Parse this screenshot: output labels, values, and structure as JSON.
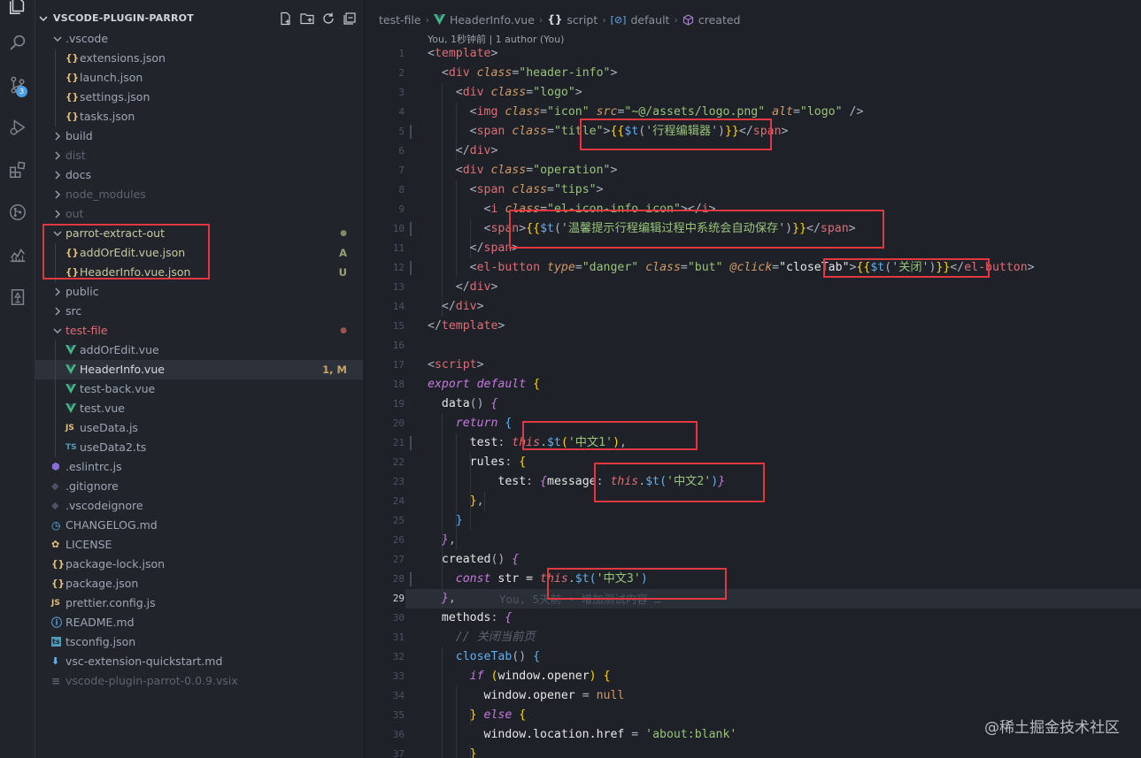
{
  "explorer": {
    "title": "VSCODE-PLUGIN-PARROT",
    "items": [
      {
        "label": ".vscode",
        "kind": "folder-open",
        "depth": 1,
        "color": "#9da5b4"
      },
      {
        "label": "extensions.json",
        "kind": "json",
        "depth": 2,
        "color": "#9da5b4"
      },
      {
        "label": "launch.json",
        "kind": "json",
        "depth": 2,
        "color": "#9da5b4"
      },
      {
        "label": "settings.json",
        "kind": "json",
        "depth": 2,
        "color": "#9da5b4"
      },
      {
        "label": "tasks.json",
        "kind": "json",
        "depth": 2,
        "color": "#9da5b4"
      },
      {
        "label": "build",
        "kind": "folder",
        "depth": 1,
        "color": "#9da5b4"
      },
      {
        "label": "dist",
        "kind": "folder",
        "depth": 1,
        "color": "#5c6370"
      },
      {
        "label": "docs",
        "kind": "folder",
        "depth": 1,
        "color": "#9da5b4"
      },
      {
        "label": "node_modules",
        "kind": "folder",
        "depth": 1,
        "color": "#5c6370"
      },
      {
        "label": "out",
        "kind": "folder",
        "depth": 1,
        "color": "#5c6370"
      },
      {
        "label": "parrot-extract-out",
        "kind": "folder-open",
        "depth": 1,
        "color": "#c5c9a0",
        "decoration": "●",
        "decoColor": "#7a8a6a"
      },
      {
        "label": "addOrEdit.vue.json",
        "kind": "json",
        "depth": 2,
        "color": "#c5c9a0",
        "decoration": "A",
        "decoColor": "#9aa27a"
      },
      {
        "label": "HeaderInfo.vue.json",
        "kind": "json",
        "depth": 2,
        "color": "#c5c9a0",
        "decoration": "U",
        "decoColor": "#9aa27a"
      },
      {
        "label": "public",
        "kind": "folder",
        "depth": 1,
        "color": "#9da5b4"
      },
      {
        "label": "src",
        "kind": "folder",
        "depth": 1,
        "color": "#9da5b4"
      },
      {
        "label": "test-file",
        "kind": "folder-open",
        "depth": 1,
        "color": "#e06c75",
        "decoration": "●",
        "decoColor": "#a0504f"
      },
      {
        "label": "addOrEdit.vue",
        "kind": "vue",
        "depth": 2,
        "color": "#9da5b4"
      },
      {
        "label": "HeaderInfo.vue",
        "kind": "vue",
        "depth": 2,
        "color": "#d7dae0",
        "decoration": "1, M",
        "decoColor": "#c9a26a",
        "selected": true
      },
      {
        "label": "test-back.vue",
        "kind": "vue",
        "depth": 2,
        "color": "#9da5b4"
      },
      {
        "label": "test.vue",
        "kind": "vue",
        "depth": 2,
        "color": "#9da5b4"
      },
      {
        "label": "useData.js",
        "kind": "js",
        "depth": 2,
        "color": "#9da5b4"
      },
      {
        "label": "useData2.ts",
        "kind": "ts",
        "depth": 2,
        "color": "#9da5b4"
      },
      {
        "label": ".eslintrc.js",
        "kind": "eslint",
        "depth": 1,
        "color": "#9da5b4"
      },
      {
        "label": ".gitignore",
        "kind": "git",
        "depth": 1,
        "color": "#9da5b4"
      },
      {
        "label": ".vscodeignore",
        "kind": "git",
        "depth": 1,
        "color": "#9da5b4"
      },
      {
        "label": "CHANGELOG.md",
        "kind": "clock",
        "depth": 1,
        "color": "#9da5b4"
      },
      {
        "label": "LICENSE",
        "kind": "license",
        "depth": 1,
        "color": "#9da5b4"
      },
      {
        "label": "package-lock.json",
        "kind": "json",
        "depth": 1,
        "color": "#9da5b4"
      },
      {
        "label": "package.json",
        "kind": "json",
        "depth": 1,
        "color": "#9da5b4"
      },
      {
        "label": "prettier.config.js",
        "kind": "js",
        "depth": 1,
        "color": "#9da5b4"
      },
      {
        "label": "README.md",
        "kind": "info",
        "depth": 1,
        "color": "#9da5b4"
      },
      {
        "label": "tsconfig.json",
        "kind": "tsconfig",
        "depth": 1,
        "color": "#9da5b4"
      },
      {
        "label": "vsc-extension-quickstart.md",
        "kind": "download",
        "depth": 1,
        "color": "#9da5b4"
      },
      {
        "label": "vscode-plugin-parrot-0.0.9.vsix",
        "kind": "lines",
        "depth": 1,
        "color": "#5c6370"
      }
    ]
  },
  "activity": {
    "scm_badge": "3"
  },
  "breadcrumb": {
    "folder": "test-file",
    "file": "HeaderInfo.vue",
    "section": "script",
    "symbol1": "default",
    "symbol2": "created"
  },
  "editor": {
    "blame_header": "You, 1秒钟前 | 1 author (You)",
    "current_line": 29,
    "inline_blame": "You, 5天前 • 增加测试内容 …",
    "lines": [
      [
        [
          "<",
          "t-pun"
        ],
        [
          "template",
          "t-tag"
        ],
        [
          ">",
          "t-pun"
        ]
      ],
      [
        [
          "  <",
          "t-pun"
        ],
        [
          "div",
          "t-tag"
        ],
        [
          " ",
          "t-pun"
        ],
        [
          "class",
          "t-attr"
        ],
        [
          "=",
          "t-pun"
        ],
        [
          "\"header-info\"",
          "t-str"
        ],
        [
          ">",
          "t-pun"
        ]
      ],
      [
        [
          "    <",
          "t-pun"
        ],
        [
          "div",
          "t-tag"
        ],
        [
          " ",
          "t-pun"
        ],
        [
          "class",
          "t-attr"
        ],
        [
          "=",
          "t-pun"
        ],
        [
          "\"logo\"",
          "t-str"
        ],
        [
          ">",
          "t-pun"
        ]
      ],
      [
        [
          "      <",
          "t-pun"
        ],
        [
          "img",
          "t-tag"
        ],
        [
          " ",
          "t-pun"
        ],
        [
          "class",
          "t-attr"
        ],
        [
          "=",
          "t-pun"
        ],
        [
          "\"icon\"",
          "t-str"
        ],
        [
          " ",
          "t-pun"
        ],
        [
          "src",
          "t-attr"
        ],
        [
          "=",
          "t-pun"
        ],
        [
          "\"~@/assets/logo.png\"",
          "t-str"
        ],
        [
          " ",
          "t-pun"
        ],
        [
          "alt",
          "t-attr"
        ],
        [
          "=",
          "t-pun"
        ],
        [
          "\"logo\"",
          "t-str"
        ],
        [
          " />",
          "t-pun"
        ]
      ],
      [
        [
          "      <",
          "t-pun"
        ],
        [
          "span",
          "t-tag"
        ],
        [
          " ",
          "t-pun"
        ],
        [
          "class",
          "t-attr"
        ],
        [
          "=",
          "t-pun"
        ],
        [
          "\"title\"",
          "t-str"
        ],
        [
          ">",
          "t-pun"
        ],
        [
          "{{",
          "t-brace"
        ],
        [
          "$t",
          "t-fn"
        ],
        [
          "('",
          "t-pun"
        ],
        [
          "行程编辑器",
          "t-str"
        ],
        [
          "')",
          "t-pun"
        ],
        [
          "}}",
          "t-brace"
        ],
        [
          "</",
          "t-pun"
        ],
        [
          "span",
          "t-tag"
        ],
        [
          ">",
          "t-pun"
        ]
      ],
      [
        [
          "    </",
          "t-pun"
        ],
        [
          "div",
          "t-tag"
        ],
        [
          ">",
          "t-pun"
        ]
      ],
      [
        [
          "    <",
          "t-pun"
        ],
        [
          "div",
          "t-tag"
        ],
        [
          " ",
          "t-pun"
        ],
        [
          "class",
          "t-attr"
        ],
        [
          "=",
          "t-pun"
        ],
        [
          "\"operation\"",
          "t-str"
        ],
        [
          ">",
          "t-pun"
        ]
      ],
      [
        [
          "      <",
          "t-pun"
        ],
        [
          "span",
          "t-tag"
        ],
        [
          " ",
          "t-pun"
        ],
        [
          "class",
          "t-attr"
        ],
        [
          "=",
          "t-pun"
        ],
        [
          "\"tips\"",
          "t-str"
        ],
        [
          ">",
          "t-pun"
        ]
      ],
      [
        [
          "        <",
          "t-pun"
        ],
        [
          "i",
          "t-tag"
        ],
        [
          " ",
          "t-pun"
        ],
        [
          "class",
          "t-attr"
        ],
        [
          "=",
          "t-pun"
        ],
        [
          "\"el-icon-info icon\"",
          "t-str"
        ],
        [
          "></",
          "t-pun"
        ],
        [
          "i",
          "t-tag"
        ],
        [
          ">",
          "t-pun"
        ]
      ],
      [
        [
          "        <",
          "t-pun"
        ],
        [
          "span",
          "t-tag"
        ],
        [
          ">",
          "t-pun"
        ],
        [
          "{{",
          "t-brace"
        ],
        [
          "$t",
          "t-fn"
        ],
        [
          "('",
          "t-pun"
        ],
        [
          "温馨提示行程编辑过程中系统会自动保存",
          "t-str"
        ],
        [
          "')",
          "t-pun"
        ],
        [
          "}}",
          "t-brace"
        ],
        [
          "</",
          "t-pun"
        ],
        [
          "span",
          "t-tag"
        ],
        [
          ">",
          "t-pun"
        ]
      ],
      [
        [
          "      </",
          "t-pun"
        ],
        [
          "span",
          "t-tag"
        ],
        [
          ">",
          "t-pun"
        ]
      ],
      [
        [
          "      <",
          "t-pun"
        ],
        [
          "el-button",
          "t-tag"
        ],
        [
          " ",
          "t-pun"
        ],
        [
          "type",
          "t-attr"
        ],
        [
          "=",
          "t-pun"
        ],
        [
          "\"danger\"",
          "t-str"
        ],
        [
          " ",
          "t-pun"
        ],
        [
          "class",
          "t-attr"
        ],
        [
          "=",
          "t-pun"
        ],
        [
          "\"but\"",
          "t-str"
        ],
        [
          " ",
          "t-pun"
        ],
        [
          "@click",
          "t-attr"
        ],
        [
          "=",
          "t-pun"
        ],
        [
          "\"closeTab\"",
          "t-white"
        ],
        [
          ">",
          "t-pun"
        ],
        [
          "{{",
          "t-brace"
        ],
        [
          "$t",
          "t-fn"
        ],
        [
          "('",
          "t-pun"
        ],
        [
          "关闭",
          "t-str"
        ],
        [
          "')",
          "t-pun"
        ],
        [
          "}}",
          "t-brace"
        ],
        [
          "</",
          "t-pun"
        ],
        [
          "el-button",
          "t-tag"
        ],
        [
          ">",
          "t-pun"
        ]
      ],
      [
        [
          "    </",
          "t-pun"
        ],
        [
          "div",
          "t-tag"
        ],
        [
          ">",
          "t-pun"
        ]
      ],
      [
        [
          "  </",
          "t-pun"
        ],
        [
          "div",
          "t-tag"
        ],
        [
          ">",
          "t-pun"
        ]
      ],
      [
        [
          "</",
          "t-pun"
        ],
        [
          "template",
          "t-tag"
        ],
        [
          ">",
          "t-pun"
        ]
      ],
      [],
      [
        [
          "<",
          "t-pun"
        ],
        [
          "script",
          "t-tag"
        ],
        [
          ">",
          "t-pun"
        ]
      ],
      [
        [
          "export default",
          "t-kw"
        ],
        [
          " ",
          "t-pun"
        ],
        [
          "{",
          "t-brace"
        ]
      ],
      [
        [
          "  ",
          "t-pun"
        ],
        [
          "data",
          "t-prop"
        ],
        [
          "() ",
          "t-pun"
        ],
        [
          "{",
          "t-kw"
        ]
      ],
      [
        [
          "    ",
          "t-pun"
        ],
        [
          "return",
          "t-kw"
        ],
        [
          " ",
          "t-pun"
        ],
        [
          "{",
          "t-fn"
        ]
      ],
      [
        [
          "      ",
          "t-pun"
        ],
        [
          "test",
          "t-prop"
        ],
        [
          ": ",
          "t-pun"
        ],
        [
          "this",
          "t-this"
        ],
        [
          ".",
          "t-pun"
        ],
        [
          "$t",
          "t-fn"
        ],
        [
          "(",
          "t-brace"
        ],
        [
          "'中文1'",
          "t-str"
        ],
        [
          ")",
          "t-brace"
        ],
        [
          ",",
          "t-pun"
        ]
      ],
      [
        [
          "      ",
          "t-pun"
        ],
        [
          "rules",
          "t-prop"
        ],
        [
          ": ",
          "t-pun"
        ],
        [
          "{",
          "t-brace"
        ]
      ],
      [
        [
          "          ",
          "t-pun"
        ],
        [
          "test",
          "t-prop"
        ],
        [
          ": ",
          "t-pun"
        ],
        [
          "{",
          "t-kw"
        ],
        [
          "message",
          "t-prop"
        ],
        [
          ": ",
          "t-pun"
        ],
        [
          "this",
          "t-this"
        ],
        [
          ".",
          "t-pun"
        ],
        [
          "$t",
          "t-fn"
        ],
        [
          "(",
          "t-fn"
        ],
        [
          "'中文2'",
          "t-str"
        ],
        [
          ")",
          "t-fn"
        ],
        [
          "}",
          "t-kw"
        ]
      ],
      [
        [
          "      ",
          "t-pun"
        ],
        [
          "}",
          "t-brace"
        ],
        [
          ",",
          "t-pun"
        ]
      ],
      [
        [
          "    ",
          "t-pun"
        ],
        [
          "}",
          "t-fn"
        ]
      ],
      [
        [
          "  ",
          "t-pun"
        ],
        [
          "}",
          "t-kw"
        ],
        [
          ",",
          "t-pun"
        ]
      ],
      [
        [
          "  ",
          "t-pun"
        ],
        [
          "created",
          "t-prop"
        ],
        [
          "() ",
          "t-pun"
        ],
        [
          "{",
          "t-kw"
        ]
      ],
      [
        [
          "    ",
          "t-pun"
        ],
        [
          "const",
          "t-kw"
        ],
        [
          " str = ",
          "t-white"
        ],
        [
          "this",
          "t-this"
        ],
        [
          ".",
          "t-pun"
        ],
        [
          "$t",
          "t-fn"
        ],
        [
          "(",
          "t-fn"
        ],
        [
          "'中文3'",
          "t-str"
        ],
        [
          ")",
          "t-fn"
        ]
      ],
      [
        [
          "  ",
          "t-pun"
        ],
        [
          "}",
          "t-kw"
        ],
        [
          ",",
          "t-pun"
        ]
      ],
      [
        [
          "  ",
          "t-pun"
        ],
        [
          "methods",
          "t-prop"
        ],
        [
          ": ",
          "t-pun"
        ],
        [
          "{",
          "t-kw"
        ]
      ],
      [
        [
          "    ",
          "t-pun"
        ],
        [
          "// 关闭当前页",
          "t-cmt"
        ]
      ],
      [
        [
          "    ",
          "t-pun"
        ],
        [
          "closeTab",
          "t-fn"
        ],
        [
          "() ",
          "t-pun"
        ],
        [
          "{",
          "t-fn"
        ]
      ],
      [
        [
          "      ",
          "t-pun"
        ],
        [
          "if",
          "t-kw"
        ],
        [
          " ",
          "t-pun"
        ],
        [
          "(",
          "t-brace"
        ],
        [
          "window.opener",
          "t-white"
        ],
        [
          ")",
          "t-brace"
        ],
        [
          " ",
          "t-pun"
        ],
        [
          "{",
          "t-brace"
        ]
      ],
      [
        [
          "        ",
          "t-pun"
        ],
        [
          "window.opener",
          "t-white"
        ],
        [
          " = ",
          "t-pun"
        ],
        [
          "null",
          "t-orange"
        ]
      ],
      [
        [
          "      ",
          "t-pun"
        ],
        [
          "}",
          "t-brace"
        ],
        [
          " ",
          "t-pun"
        ],
        [
          "else",
          "t-kw"
        ],
        [
          " ",
          "t-pun"
        ],
        [
          "{",
          "t-brace"
        ]
      ],
      [
        [
          "        ",
          "t-pun"
        ],
        [
          "window.location.href",
          "t-white"
        ],
        [
          " = ",
          "t-pun"
        ],
        [
          "'about:blank'",
          "t-str"
        ]
      ],
      [
        [
          "      ",
          "t-pun"
        ],
        [
          "}",
          "t-brace"
        ]
      ]
    ]
  },
  "watermark": "@稀土掘金技术社区"
}
